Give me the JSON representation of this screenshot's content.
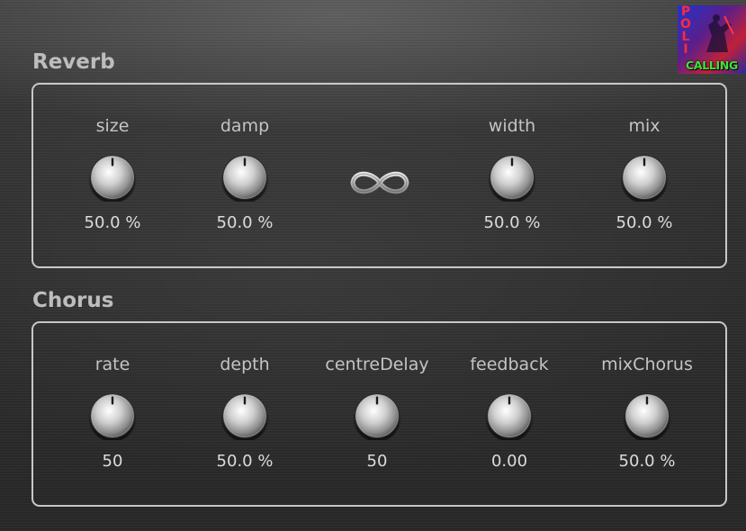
{
  "logo": {
    "brand_text": "CALLING",
    "side_text": "POLI"
  },
  "reverb": {
    "title": "Reverb",
    "controls": [
      {
        "label": "size",
        "value": "50.0 %",
        "level": 0.5
      },
      {
        "label": "damp",
        "value": "50.0 %",
        "level": 0.5
      },
      {
        "label": "width",
        "value": "50.0 %",
        "level": 0.5
      },
      {
        "label": "mix",
        "value": "50.0 %",
        "level": 0.5
      }
    ],
    "freeze_icon": "infinity-icon"
  },
  "chorus": {
    "title": "Chorus",
    "controls": [
      {
        "label": "rate",
        "value": "50",
        "level": 0.5
      },
      {
        "label": "depth",
        "value": "50.0 %",
        "level": 0.5
      },
      {
        "label": "centreDelay",
        "value": "50",
        "level": 0.5
      },
      {
        "label": "feedback",
        "value": "0.00",
        "level": 0.5
      },
      {
        "label": "mixChorus",
        "value": "50.0 %",
        "level": 0.5
      }
    ]
  },
  "colors": {
    "panel_border": "#c8c8c8",
    "label": "#c4c4c4",
    "value": "#dcdcdc",
    "logo_text": "#39e639"
  }
}
